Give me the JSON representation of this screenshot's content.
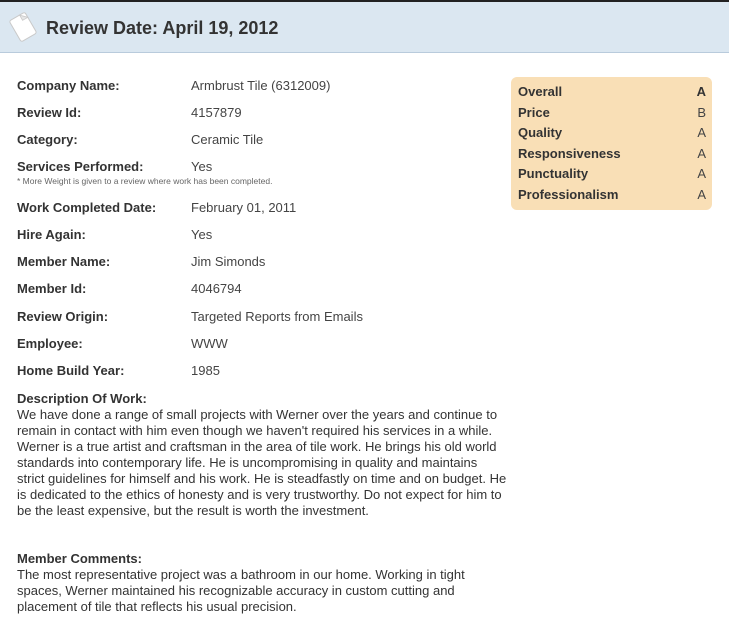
{
  "header": {
    "title": "Review Date: April 19, 2012",
    "icon": "document-icon"
  },
  "details": [
    {
      "label": "Company Name:",
      "value": "Armbrust Tile (6312009)"
    },
    {
      "label": "Review Id:",
      "value": "4157879"
    },
    {
      "label": "Category:",
      "value": "Ceramic Tile"
    },
    {
      "label": "Services Performed:",
      "value": "Yes"
    },
    {
      "label": "Work Completed Date:",
      "value": "February 01, 2011"
    },
    {
      "label": "Hire Again:",
      "value": "Yes"
    },
    {
      "label": "Member Name:",
      "value": "Jim Simonds"
    },
    {
      "label": "Member Id:",
      "value": "4046794"
    },
    {
      "label": "Review Origin:",
      "value": "Targeted Reports from Emails"
    },
    {
      "label": "Employee:",
      "value": "WWW"
    },
    {
      "label": "Home Build Year:",
      "value": "1985"
    }
  ],
  "services_note": "* More Weight is given to a review where work has been completed.",
  "description": {
    "title": "Description Of Work:",
    "text": "We have done a range of small projects with Werner over the years and continue to remain in contact with him even though we haven't required his services in a while. Werner is a true artist and craftsman in the area of tile work. He brings his old world standards into contemporary life. He is uncompromising in quality and maintains strict guidelines for himself and his work. He is steadfastly on time and on budget. He is dedicated to the ethics of honesty and is very trustworthy. Do not expect for him to be the least expensive, but the result is worth the investment."
  },
  "comments": {
    "title": "Member Comments:",
    "text": "The most representative project was a bathroom in our home. Working in tight spaces, Werner maintained his recognizable accuracy in custom cutting and placement of tile that reflects his usual precision."
  },
  "grades": [
    {
      "label": "Overall",
      "value": "A"
    },
    {
      "label": "Price",
      "value": "B"
    },
    {
      "label": "Quality",
      "value": "A"
    },
    {
      "label": "Responsiveness",
      "value": "A"
    },
    {
      "label": "Punctuality",
      "value": "A"
    },
    {
      "label": "Professionalism",
      "value": "A"
    }
  ],
  "colors": {
    "header_bg": "#dbe7f1",
    "grades_bg": "#f9dfb6"
  }
}
